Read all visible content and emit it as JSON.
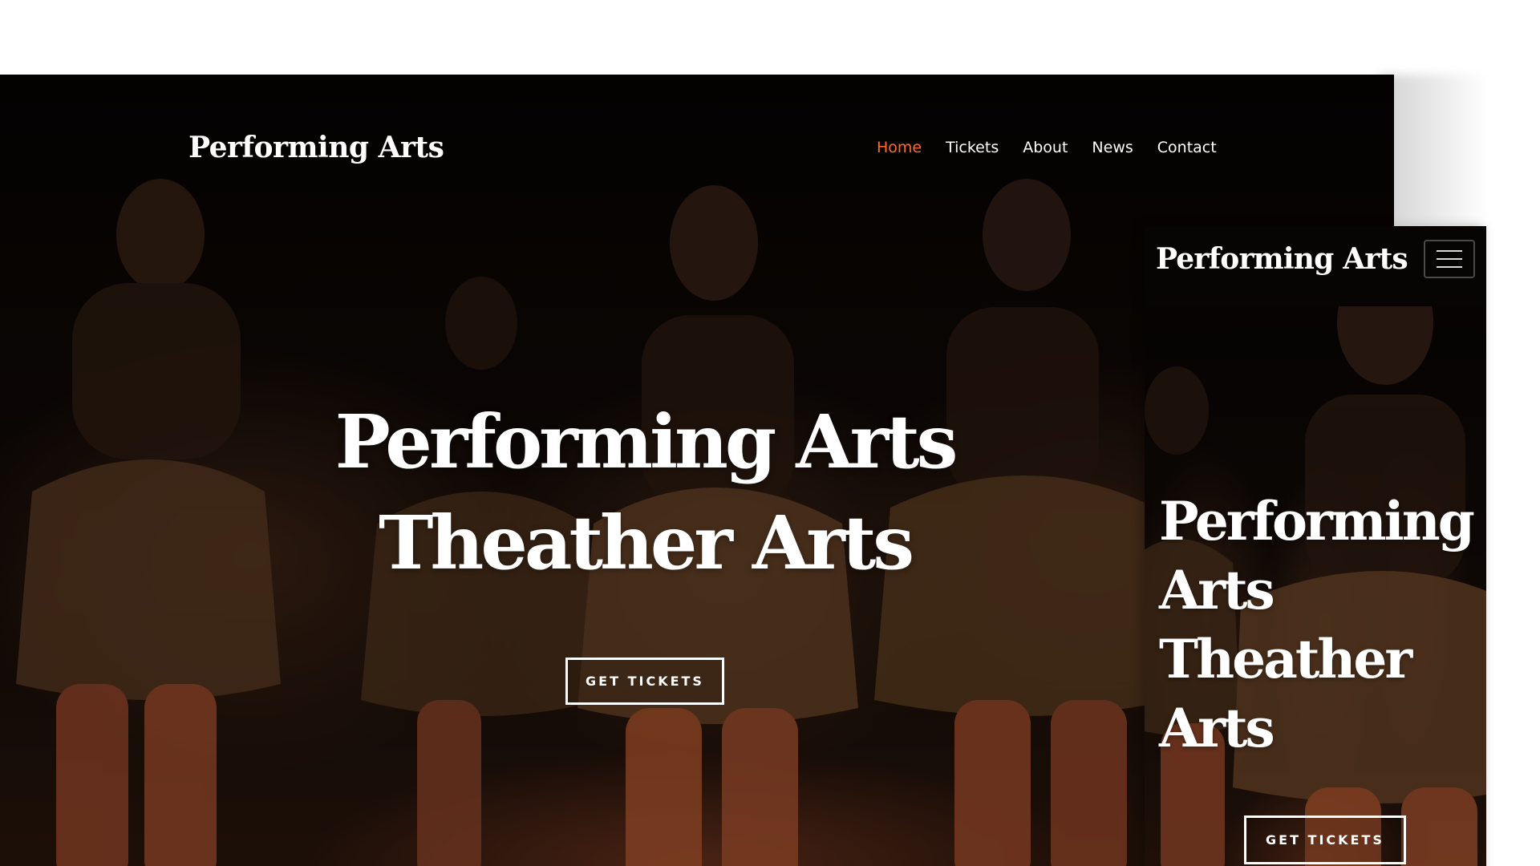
{
  "colors": {
    "accent": "#ff6a2a",
    "text": "#ffffff",
    "background": "#060403"
  },
  "desktop": {
    "logo": "Performing Arts",
    "nav": [
      {
        "label": "Home",
        "active": true
      },
      {
        "label": "Tickets",
        "active": false
      },
      {
        "label": "About",
        "active": false
      },
      {
        "label": "News",
        "active": false
      },
      {
        "label": "Contact",
        "active": false
      }
    ],
    "hero": {
      "line1": "Performing Arts",
      "line2": "Theather Arts",
      "cta": "GET TICKETS"
    }
  },
  "mobile": {
    "logo": "Performing Arts",
    "menu_icon": "hamburger-icon",
    "hero": {
      "line1": "Performing",
      "line2": "Arts",
      "line3": "Theather",
      "line4": "Arts",
      "cta": "GET TICKETS"
    }
  }
}
